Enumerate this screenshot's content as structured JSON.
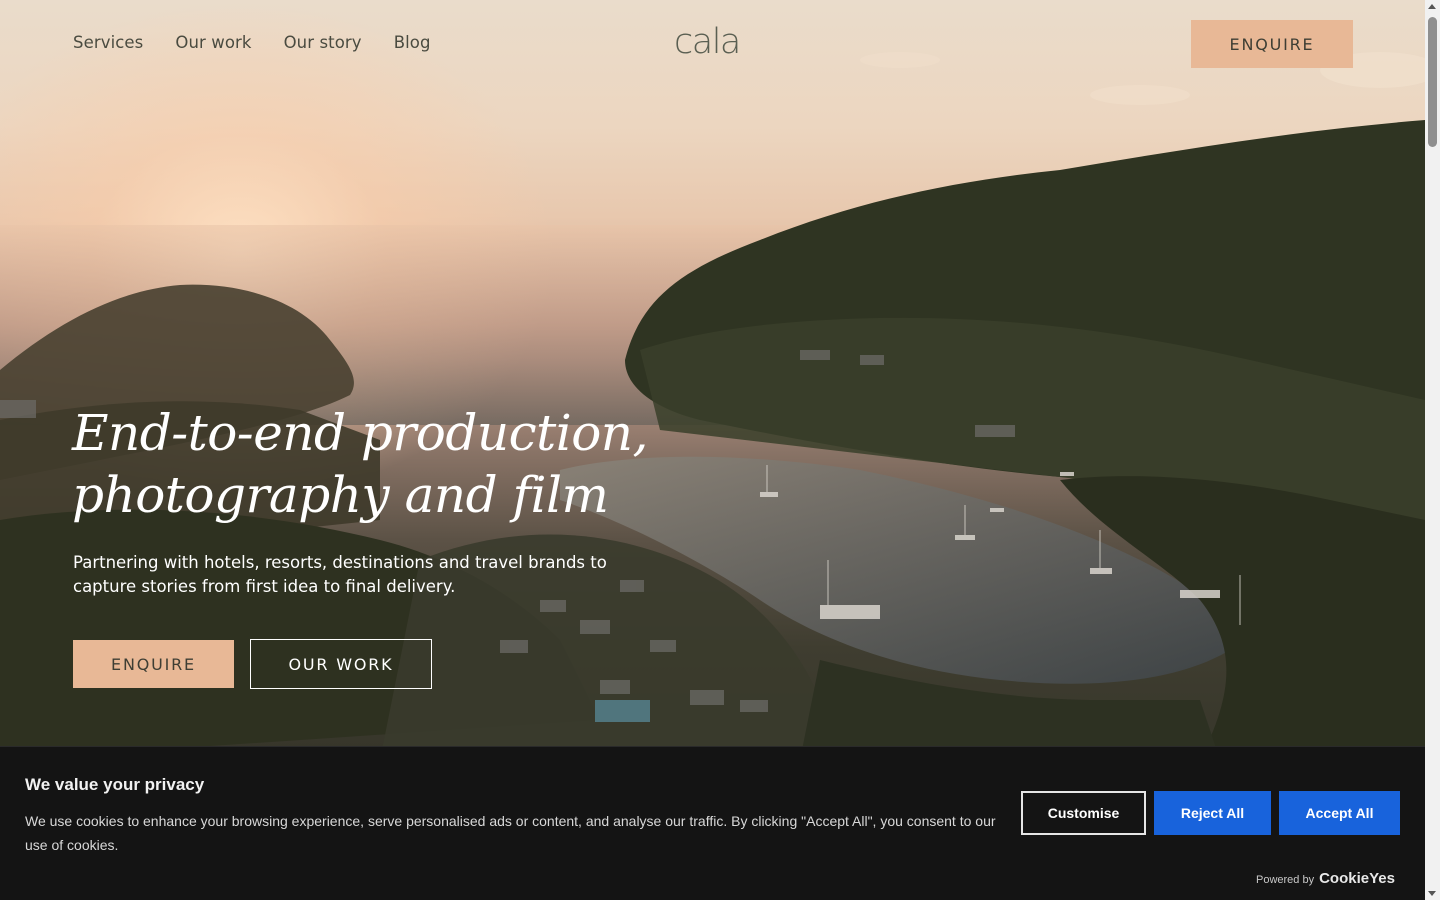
{
  "nav": {
    "links": [
      "Services",
      "Our work",
      "Our story",
      "Blog"
    ],
    "logo": "cala",
    "enquire_label": "ENQUIRE"
  },
  "hero": {
    "headline_line1": "End-to-end production,",
    "headline_line2": "photography and film",
    "subtext": "Partnering with hotels, resorts, destinations and travel brands to capture stories from first idea to final delivery.",
    "enquire_label": "ENQUIRE",
    "our_work_label": "OUR WORK"
  },
  "cookie_banner": {
    "title": "We value your privacy",
    "text": "We use cookies to enhance your browsing experience, serve personalised ads or content, and analyse our traffic. By clicking \"Accept All\", you consent to our use of cookies.",
    "customise_label": "Customise",
    "reject_label": "Reject All",
    "accept_label": "Accept All",
    "powered_by": "Powered by",
    "brand": "CookieYes"
  },
  "colors": {
    "accent_peach": "#e8b896",
    "cookie_blue": "#1863dc",
    "cookie_bg": "#141414"
  }
}
